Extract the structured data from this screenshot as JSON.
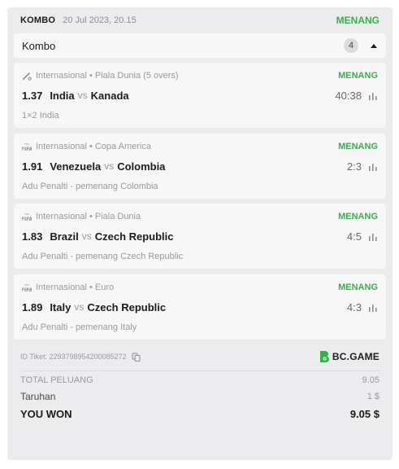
{
  "header": {
    "label": "KOMBO",
    "date": "20 Jul 2023, 20.15",
    "status": "MENANG"
  },
  "combo": {
    "title": "Kombo",
    "count": "4"
  },
  "bets": [
    {
      "icon": "cricket-icon",
      "category": "Internasional",
      "league": "Piala Dunia (5 overs)",
      "status": "MENANG",
      "odds": "1.37",
      "home": "India",
      "vs": "vs",
      "away": "Kanada",
      "score": "40:38",
      "selection": "1×2 India"
    },
    {
      "icon": "fifa-icon",
      "category": "Internasional",
      "league": "Copa America",
      "status": "MENANG",
      "odds": "1.91",
      "home": "Venezuela",
      "vs": "vs",
      "away": "Colombia",
      "score": "2:3",
      "selection": "Adu Penalti - pemenang Colombia"
    },
    {
      "icon": "fifa-icon",
      "category": "Internasional",
      "league": "Piala Dunia",
      "status": "MENANG",
      "odds": "1.83",
      "home": "Brazil",
      "vs": "vs",
      "away": "Czech Republic",
      "score": "4:5",
      "selection": "Adu Penalti - pemenang Czech Republic"
    },
    {
      "icon": "fifa-icon",
      "category": "Internasional",
      "league": "Euro",
      "status": "MENANG",
      "odds": "1.89",
      "home": "Italy",
      "vs": "vs",
      "away": "Czech Republic",
      "score": "4:3",
      "selection": "Adu Penalti - pemenang Italy"
    }
  ],
  "ticket": {
    "id_label": "ID Tiket: 2293798954200085272",
    "brand": "BC.GAME"
  },
  "summary": {
    "total_odds_label": "TOTAL PELUANG",
    "total_odds": "9.05",
    "stake_label": "Taruhan",
    "stake": "1 $",
    "won_label": "YOU WON",
    "won": "9.05 $"
  },
  "colors": {
    "win_green": "#35b34a",
    "logo_green": "#2fb344",
    "card_bg": "#f7f7f8",
    "panel_bg": "#ececee"
  }
}
